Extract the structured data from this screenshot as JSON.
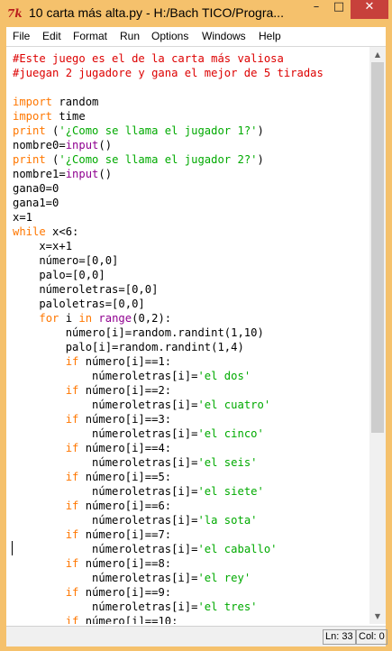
{
  "window": {
    "title": "10 carta más alta.py - H:/Bach TICO/Progra...",
    "icon": "python-idle-icon",
    "controls": {
      "minimize": "–",
      "maximize": "□",
      "close": "✕"
    }
  },
  "menu": [
    "File",
    "Edit",
    "Format",
    "Run",
    "Options",
    "Windows",
    "Help"
  ],
  "code": [
    [
      [
        "comment",
        "#Este juego es el de la carta más valiosa"
      ]
    ],
    [
      [
        "comment",
        "#juegan 2 jugadore y gana el mejor de 5 tiradas"
      ]
    ],
    [],
    [
      [
        "kw",
        "import"
      ],
      [
        "n",
        " random"
      ]
    ],
    [
      [
        "kw",
        "import"
      ],
      [
        "n",
        " time"
      ]
    ],
    [
      [
        "kw",
        "print"
      ],
      [
        "n",
        " ("
      ],
      [
        "str",
        "'¿Como se llama el jugador 1?'"
      ],
      [
        "n",
        ")"
      ]
    ],
    [
      [
        "n",
        "nombre0="
      ],
      [
        "bi",
        "input"
      ],
      [
        "n",
        "()"
      ]
    ],
    [
      [
        "kw",
        "print"
      ],
      [
        "n",
        " ("
      ],
      [
        "str",
        "'¿Como se llama el jugador 2?'"
      ],
      [
        "n",
        ")"
      ]
    ],
    [
      [
        "n",
        "nombre1="
      ],
      [
        "bi",
        "input"
      ],
      [
        "n",
        "()"
      ]
    ],
    [
      [
        "n",
        "gana0=0"
      ]
    ],
    [
      [
        "n",
        "gana1=0"
      ]
    ],
    [
      [
        "n",
        "x=1"
      ]
    ],
    [
      [
        "kw",
        "while"
      ],
      [
        "n",
        " x<6:"
      ]
    ],
    [
      [
        "n",
        "    x=x+1"
      ]
    ],
    [
      [
        "n",
        "    número=[0,0]"
      ]
    ],
    [
      [
        "n",
        "    palo=[0,0]"
      ]
    ],
    [
      [
        "n",
        "    númeroletras=[0,0]"
      ]
    ],
    [
      [
        "n",
        "    paloletras=[0,0]"
      ]
    ],
    [
      [
        "n",
        "    "
      ],
      [
        "kw",
        "for"
      ],
      [
        "n",
        " i "
      ],
      [
        "kw",
        "in"
      ],
      [
        "n",
        " "
      ],
      [
        "bi",
        "range"
      ],
      [
        "n",
        "(0,2):"
      ]
    ],
    [
      [
        "n",
        "        número[i]=random.randint(1,10)"
      ]
    ],
    [
      [
        "n",
        "        palo[i]=random.randint(1,4)"
      ]
    ],
    [
      [
        "n",
        "        "
      ],
      [
        "kw",
        "if"
      ],
      [
        "n",
        " número[i]==1:"
      ]
    ],
    [
      [
        "n",
        "            númeroletras[i]="
      ],
      [
        "str",
        "'el dos'"
      ]
    ],
    [
      [
        "n",
        "        "
      ],
      [
        "kw",
        "if"
      ],
      [
        "n",
        " número[i]==2:"
      ]
    ],
    [
      [
        "n",
        "            númeroletras[i]="
      ],
      [
        "str",
        "'el cuatro'"
      ]
    ],
    [
      [
        "n",
        "        "
      ],
      [
        "kw",
        "if"
      ],
      [
        "n",
        " número[i]==3:"
      ]
    ],
    [
      [
        "n",
        "            númeroletras[i]="
      ],
      [
        "str",
        "'el cinco'"
      ]
    ],
    [
      [
        "n",
        "        "
      ],
      [
        "kw",
        "if"
      ],
      [
        "n",
        " número[i]==4:"
      ]
    ],
    [
      [
        "n",
        "            númeroletras[i]="
      ],
      [
        "str",
        "'el seis'"
      ]
    ],
    [
      [
        "n",
        "        "
      ],
      [
        "kw",
        "if"
      ],
      [
        "n",
        " número[i]==5:"
      ]
    ],
    [
      [
        "n",
        "            númeroletras[i]="
      ],
      [
        "str",
        "'el siete'"
      ]
    ],
    [
      [
        "n",
        "        "
      ],
      [
        "kw",
        "if"
      ],
      [
        "n",
        " número[i]==6:"
      ]
    ],
    [
      [
        "n",
        "            númeroletras[i]="
      ],
      [
        "str",
        "'la sota'"
      ]
    ],
    [
      [
        "n",
        "        "
      ],
      [
        "kw",
        "if"
      ],
      [
        "n",
        " número[i]==7:"
      ]
    ],
    [
      [
        "n",
        "            númeroletras[i]="
      ],
      [
        "str",
        "'el caballo'"
      ]
    ],
    [
      [
        "n",
        "        "
      ],
      [
        "kw",
        "if"
      ],
      [
        "n",
        " número[i]==8:"
      ]
    ],
    [
      [
        "n",
        "            númeroletras[i]="
      ],
      [
        "str",
        "'el rey'"
      ]
    ],
    [
      [
        "n",
        "        "
      ],
      [
        "kw",
        "if"
      ],
      [
        "n",
        " número[i]==9:"
      ]
    ],
    [
      [
        "n",
        "            númeroletras[i]="
      ],
      [
        "str",
        "'el tres'"
      ]
    ],
    [
      [
        "n",
        "        "
      ],
      [
        "kw",
        "if"
      ],
      [
        "n",
        " número[i]==10:"
      ]
    ]
  ],
  "status": {
    "line": "Ln: 33",
    "col": "Col: 0"
  },
  "colors": {
    "frame": "#f5c16c",
    "comment": "#dd0000",
    "keyword": "#ff7700",
    "builtin": "#900090",
    "string": "#00aa00",
    "close_button": "#c7413b"
  }
}
